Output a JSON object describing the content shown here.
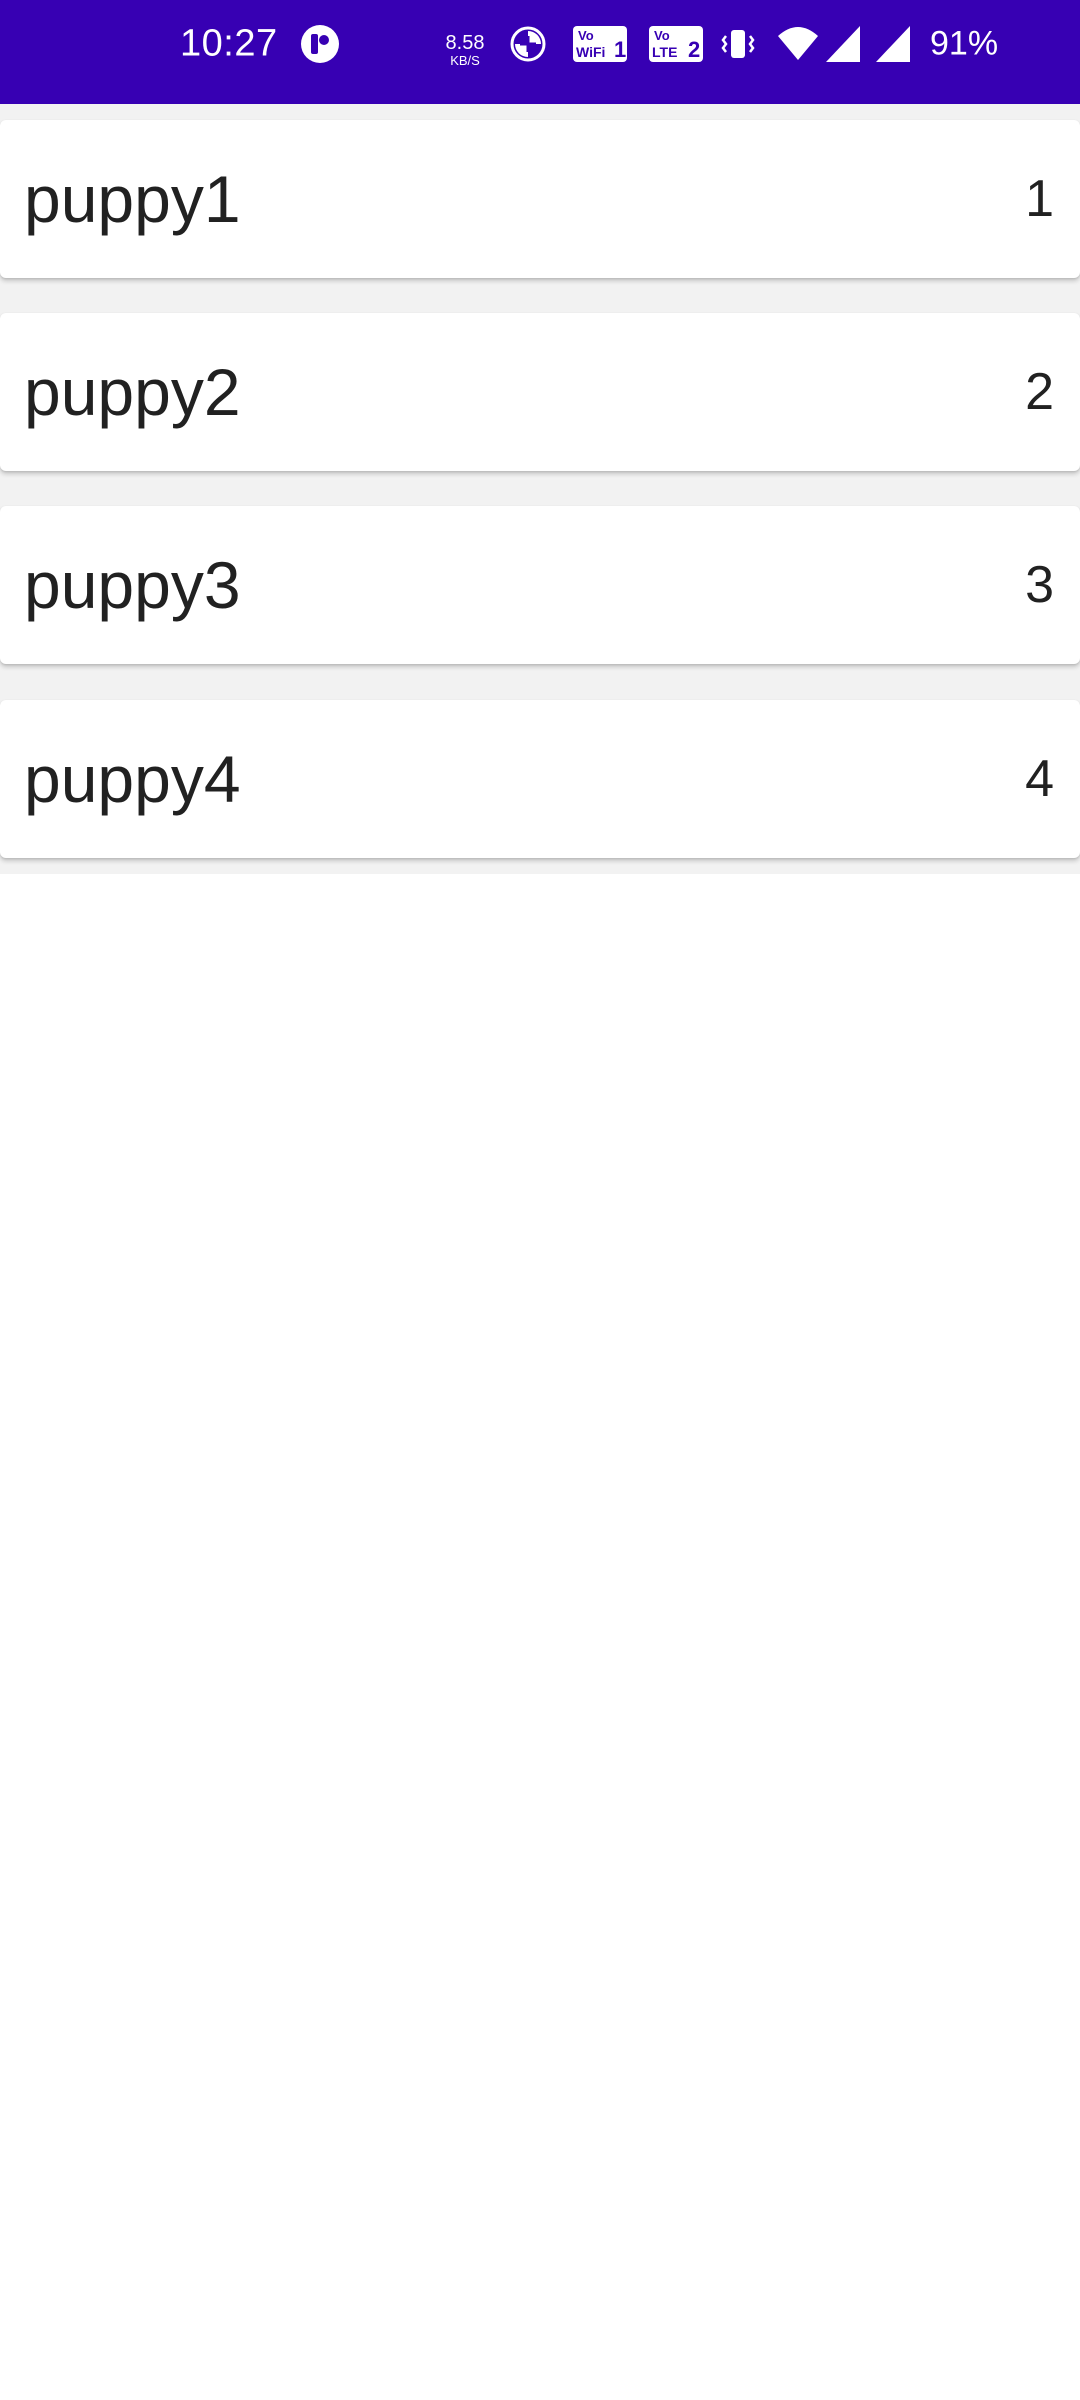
{
  "status_bar": {
    "time": "10:27",
    "net_speed_value": "8.58",
    "net_speed_unit": "KB/S",
    "battery_percent": "91%",
    "background_color": "#3700b3",
    "icons": [
      "notification-app-icon",
      "data-saver-icon",
      "vowifi-icon",
      "volte-icon",
      "vibrate-icon",
      "wifi-icon",
      "signal-icon",
      "signal-icon"
    ],
    "vowifi_top": "Vo",
    "vowifi_bottom": "WiFi",
    "vowifi_sim": "1",
    "volte_top": "Vo",
    "volte_bottom": "LTE",
    "volte_sim": "2"
  },
  "puppies": [
    {
      "name": "puppy1",
      "number": "1"
    },
    {
      "name": "puppy2",
      "number": "2"
    },
    {
      "name": "puppy3",
      "number": "3"
    },
    {
      "name": "puppy4",
      "number": "4"
    }
  ]
}
